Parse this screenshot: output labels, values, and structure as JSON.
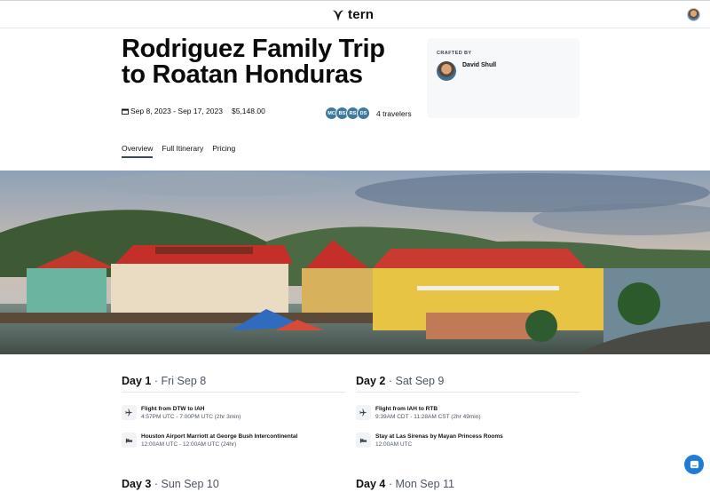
{
  "header": {
    "logo_text": "tern"
  },
  "trip": {
    "title": "Rodriguez Family Trip to Roatan Honduras",
    "dates": "Sep 8, 2023 - Sep 17, 2023",
    "price": "$5,148.00",
    "travelers_count": "4 travelers",
    "travelers": [
      {
        "initials": "MC"
      },
      {
        "initials": "BS"
      },
      {
        "initials": "RS"
      },
      {
        "initials": "DS"
      }
    ]
  },
  "crafted": {
    "label": "CRAFTED BY",
    "name": "David Shull"
  },
  "tabs": [
    {
      "label": "Overview",
      "active": true
    },
    {
      "label": "Full Itinerary",
      "active": false
    },
    {
      "label": "Pricing",
      "active": false
    }
  ],
  "days": [
    {
      "num": "Day 1",
      "date": "Fri Sep 8",
      "items": [
        {
          "icon": "airplane-icon",
          "title": "Flight from DTW to IAH",
          "sub": "4:57PM UTC - 7:00PM UTC (2hr 3min)"
        },
        {
          "icon": "bed-icon",
          "title": "Houston Airport Marriott at George Bush Intercontinental",
          "sub": "12:00AM UTC - 12:00AM UTC (24hr)"
        }
      ]
    },
    {
      "num": "Day 2",
      "date": "Sat Sep 9",
      "items": [
        {
          "icon": "airplane-icon",
          "title": "Flight from IAH to RTB",
          "sub": "9:39AM CDT - 11:28AM CST (2hr 49min)"
        },
        {
          "icon": "bed-icon",
          "title": "Stay at Las Sirenas by Mayan Princess Rooms",
          "sub": "12:00AM UTC"
        }
      ]
    },
    {
      "num": "Day 3",
      "date": "Sun Sep 10"
    },
    {
      "num": "Day 4",
      "date": "Mon Sep 11"
    }
  ],
  "colors": {
    "badge": "#3e7aa0",
    "chat": "#1f7bd8",
    "accent_text": "#4b5563"
  }
}
